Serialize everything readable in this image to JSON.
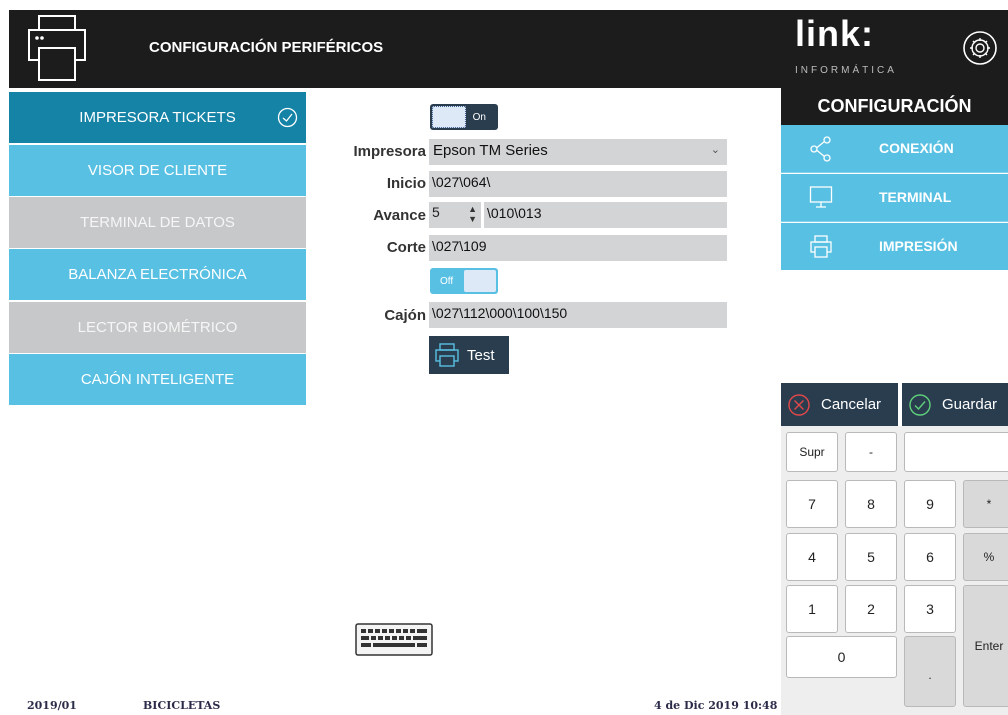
{
  "header": {
    "title": "CONFIGURACIÓN PERIFÉRICOS"
  },
  "brand": {
    "name": "link:",
    "subtitle": "INFORMÁTICA"
  },
  "sidebar": {
    "items": [
      {
        "label": "IMPRESORA TICKETS",
        "state": "active"
      },
      {
        "label": "VISOR DE CLIENTE",
        "state": "enabled"
      },
      {
        "label": "TERMINAL DE DATOS",
        "state": "disabled"
      },
      {
        "label": "BALANZA ELECTRÓNICA",
        "state": "enabled"
      },
      {
        "label": "LECTOR BIOMÉTRICO",
        "state": "disabled"
      },
      {
        "label": "CAJÓN INTELIGENTE",
        "state": "enabled"
      }
    ]
  },
  "form": {
    "printer_toggle": "On",
    "impresora_label": "Impresora",
    "impresora_value": "Epson TM Series",
    "inicio_label": "Inicio",
    "inicio_value": "\\027\\064\\",
    "avance_label": "Avance",
    "avance_value": "5",
    "avance_code": "\\010\\013",
    "corte_label": "Corte",
    "corte_value": "\\027\\109",
    "drawer_toggle": "Off",
    "cajon_label": "Cajón",
    "cajon_value": "\\027\\112\\000\\100\\150",
    "test_label": "Test"
  },
  "config": {
    "title": "CONFIGURACIÓN",
    "items": [
      {
        "label": "CONEXIÓN",
        "icon": "share-icon"
      },
      {
        "label": "TERMINAL",
        "icon": "monitor-icon"
      },
      {
        "label": "IMPRESIÓN",
        "icon": "printer-icon"
      }
    ]
  },
  "actions": {
    "cancel": "Cancelar",
    "save": "Guardar"
  },
  "keypad": {
    "supr": "Supr",
    "minus": "-",
    "k7": "7",
    "k8": "8",
    "k9": "9",
    "star": "*",
    "k4": "4",
    "k5": "5",
    "k6": "6",
    "percent": "%",
    "k1": "1",
    "k2": "2",
    "k3": "3",
    "enter": "Enter",
    "k0": "0",
    "dot": "."
  },
  "status": {
    "period": "2019/01",
    "store": "BICICLETAS",
    "datetime": "4 de Dic 2019 10:48"
  },
  "colors": {
    "accent": "#58c0e3",
    "active": "#1583a6",
    "dark": "#1c1c1c",
    "button": "#2a3d4f",
    "disabled": "#c6c8c9"
  }
}
